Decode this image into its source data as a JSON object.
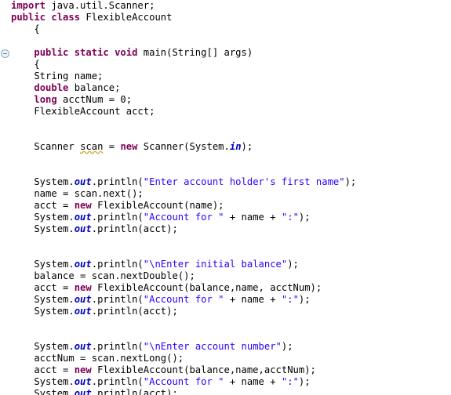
{
  "editor": {
    "language": "Java",
    "background_color": "#ffffff",
    "keyword_color": "#7f0055",
    "string_color": "#2a00ff",
    "static_field_color": "#0000c0",
    "plain_text_color": "#000000",
    "warning_underline_color": "#d4a017",
    "fold_marker_label": "collapse"
  },
  "code": {
    "lines": [
      {
        "n": 1,
        "tokens": [
          {
            "t": "kw",
            "v": "import"
          },
          {
            "t": "pl",
            "v": " java.util.Scanner;"
          }
        ]
      },
      {
        "n": 2,
        "tokens": [
          {
            "t": "kw",
            "v": "public class"
          },
          {
            "t": "pl",
            "v": " FlexibleAccount"
          }
        ]
      },
      {
        "n": 3,
        "tokens": [
          {
            "t": "pl",
            "v": "    {"
          }
        ]
      },
      {
        "n": 4,
        "tokens": [
          {
            "t": "pl",
            "v": ""
          }
        ]
      },
      {
        "n": 5,
        "tokens": [
          {
            "t": "pl",
            "v": "    "
          },
          {
            "t": "kw",
            "v": "public static void"
          },
          {
            "t": "pl",
            "v": " main(String[] args)"
          }
        ],
        "fold": true
      },
      {
        "n": 6,
        "tokens": [
          {
            "t": "pl",
            "v": "    {"
          }
        ]
      },
      {
        "n": 7,
        "tokens": [
          {
            "t": "pl",
            "v": "    String name;"
          }
        ]
      },
      {
        "n": 8,
        "tokens": [
          {
            "t": "pl",
            "v": "    "
          },
          {
            "t": "kw",
            "v": "double"
          },
          {
            "t": "pl",
            "v": " balance;"
          }
        ]
      },
      {
        "n": 9,
        "tokens": [
          {
            "t": "pl",
            "v": "    "
          },
          {
            "t": "kw",
            "v": "long"
          },
          {
            "t": "pl",
            "v": " acctNum = 0;"
          }
        ]
      },
      {
        "n": 10,
        "tokens": [
          {
            "t": "pl",
            "v": "    FlexibleAccount acct;"
          }
        ]
      },
      {
        "n": 11,
        "tokens": [
          {
            "t": "pl",
            "v": ""
          }
        ]
      },
      {
        "n": 12,
        "tokens": [
          {
            "t": "pl",
            "v": ""
          }
        ]
      },
      {
        "n": 13,
        "tokens": [
          {
            "t": "pl",
            "v": "    Scanner "
          },
          {
            "t": "warn",
            "v": "scan"
          },
          {
            "t": "pl",
            "v": " = "
          },
          {
            "t": "kw",
            "v": "new"
          },
          {
            "t": "pl",
            "v": " Scanner(System."
          },
          {
            "t": "fld",
            "v": "in"
          },
          {
            "t": "pl",
            "v": ");"
          }
        ]
      },
      {
        "n": 14,
        "tokens": [
          {
            "t": "pl",
            "v": ""
          }
        ]
      },
      {
        "n": 15,
        "tokens": [
          {
            "t": "pl",
            "v": ""
          }
        ]
      },
      {
        "n": 16,
        "tokens": [
          {
            "t": "pl",
            "v": "    System."
          },
          {
            "t": "fld",
            "v": "out"
          },
          {
            "t": "pl",
            "v": ".println("
          },
          {
            "t": "str",
            "v": "\"Enter account holder's first name\""
          },
          {
            "t": "pl",
            "v": ");"
          }
        ]
      },
      {
        "n": 17,
        "tokens": [
          {
            "t": "pl",
            "v": "    name = scan.next();"
          }
        ]
      },
      {
        "n": 18,
        "tokens": [
          {
            "t": "pl",
            "v": "    acct = "
          },
          {
            "t": "kw",
            "v": "new"
          },
          {
            "t": "pl",
            "v": " FlexibleAccount(name);"
          }
        ]
      },
      {
        "n": 19,
        "tokens": [
          {
            "t": "pl",
            "v": "    System."
          },
          {
            "t": "fld",
            "v": "out"
          },
          {
            "t": "pl",
            "v": ".println("
          },
          {
            "t": "str",
            "v": "\"Account for \""
          },
          {
            "t": "pl",
            "v": " + name + "
          },
          {
            "t": "str",
            "v": "\":\""
          },
          {
            "t": "pl",
            "v": ");"
          }
        ]
      },
      {
        "n": 20,
        "tokens": [
          {
            "t": "pl",
            "v": "    System."
          },
          {
            "t": "fld",
            "v": "out"
          },
          {
            "t": "pl",
            "v": ".println(acct);"
          }
        ]
      },
      {
        "n": 21,
        "tokens": [
          {
            "t": "pl",
            "v": ""
          }
        ]
      },
      {
        "n": 22,
        "tokens": [
          {
            "t": "pl",
            "v": ""
          }
        ]
      },
      {
        "n": 23,
        "tokens": [
          {
            "t": "pl",
            "v": "    System."
          },
          {
            "t": "fld",
            "v": "out"
          },
          {
            "t": "pl",
            "v": ".println("
          },
          {
            "t": "str",
            "v": "\"\\nEnter initial balance\""
          },
          {
            "t": "pl",
            "v": ");"
          }
        ]
      },
      {
        "n": 24,
        "tokens": [
          {
            "t": "pl",
            "v": "    balance = scan.nextDouble();"
          }
        ]
      },
      {
        "n": 25,
        "tokens": [
          {
            "t": "pl",
            "v": "    acct = "
          },
          {
            "t": "kw",
            "v": "new"
          },
          {
            "t": "pl",
            "v": " FlexibleAccount(balance,name, acctNum);"
          }
        ]
      },
      {
        "n": 26,
        "tokens": [
          {
            "t": "pl",
            "v": "    System."
          },
          {
            "t": "fld",
            "v": "out"
          },
          {
            "t": "pl",
            "v": ".println("
          },
          {
            "t": "str",
            "v": "\"Account for \""
          },
          {
            "t": "pl",
            "v": " + name + "
          },
          {
            "t": "str",
            "v": "\":\""
          },
          {
            "t": "pl",
            "v": ");"
          }
        ]
      },
      {
        "n": 27,
        "tokens": [
          {
            "t": "pl",
            "v": "    System."
          },
          {
            "t": "fld",
            "v": "out"
          },
          {
            "t": "pl",
            "v": ".println(acct);"
          }
        ]
      },
      {
        "n": 28,
        "tokens": [
          {
            "t": "pl",
            "v": ""
          }
        ]
      },
      {
        "n": 29,
        "tokens": [
          {
            "t": "pl",
            "v": ""
          }
        ]
      },
      {
        "n": 30,
        "tokens": [
          {
            "t": "pl",
            "v": "    System."
          },
          {
            "t": "fld",
            "v": "out"
          },
          {
            "t": "pl",
            "v": ".println("
          },
          {
            "t": "str",
            "v": "\"\\nEnter account number\""
          },
          {
            "t": "pl",
            "v": ");"
          }
        ]
      },
      {
        "n": 31,
        "tokens": [
          {
            "t": "pl",
            "v": "    acctNum = scan.nextLong();"
          }
        ]
      },
      {
        "n": 32,
        "tokens": [
          {
            "t": "pl",
            "v": "    acct = "
          },
          {
            "t": "kw",
            "v": "new"
          },
          {
            "t": "pl",
            "v": " FlexibleAccount(balance,name,acctNum);"
          }
        ]
      },
      {
        "n": 33,
        "tokens": [
          {
            "t": "pl",
            "v": "    System."
          },
          {
            "t": "fld",
            "v": "out"
          },
          {
            "t": "pl",
            "v": ".println("
          },
          {
            "t": "str",
            "v": "\"Account for \""
          },
          {
            "t": "pl",
            "v": " + name + "
          },
          {
            "t": "str",
            "v": "\":\""
          },
          {
            "t": "pl",
            "v": ");"
          }
        ]
      },
      {
        "n": 34,
        "tokens": [
          {
            "t": "pl",
            "v": "    System."
          },
          {
            "t": "fld",
            "v": "out"
          },
          {
            "t": "pl",
            "v": ".println(acct);"
          }
        ]
      }
    ]
  }
}
